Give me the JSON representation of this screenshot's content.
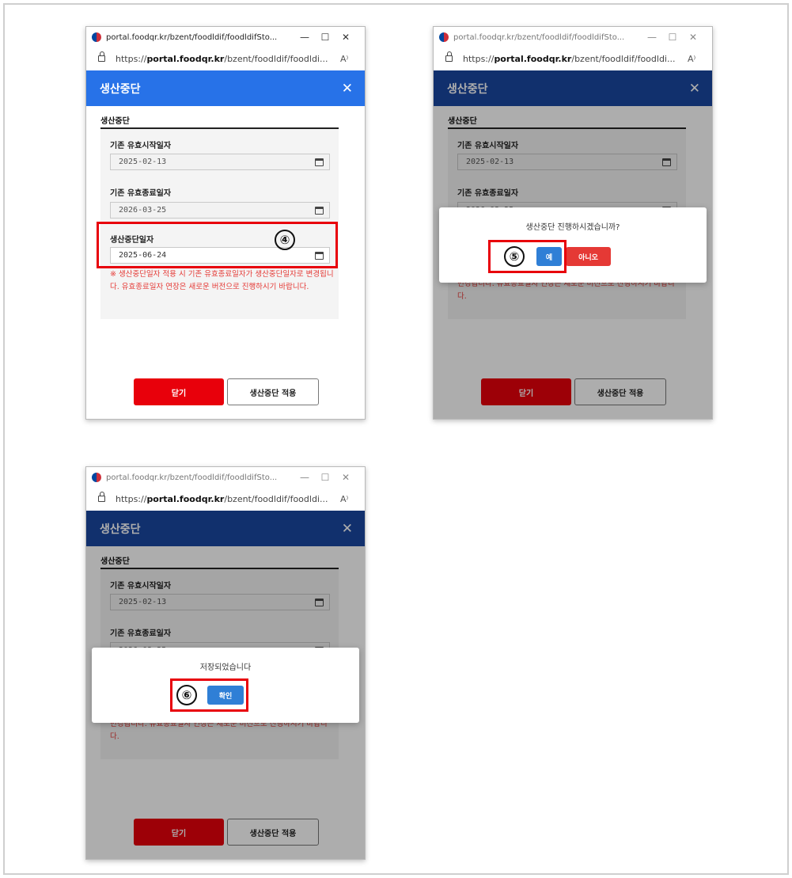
{
  "colors": {
    "header_active": "#2772e8",
    "header_dimmed": "#1a47a1",
    "primary_red": "#e8000b",
    "confirm_blue": "#2f7fd6",
    "warning_red": "#e53935"
  },
  "browser": {
    "title": "portal.foodqr.kr/bzent/foodldif/foodldifSto...",
    "url_prefix": "https://",
    "url_domain": "portal.foodqr.kr",
    "url_path": "/bzent/foodldif/foodldi...",
    "minimize": "—",
    "maximize": "☐",
    "close": "✕",
    "read_aloud": "A⁾"
  },
  "popup": {
    "header_title": "생산중단",
    "close_symbol": "✕",
    "section_title": "생산중단",
    "fields": [
      {
        "label": "기존 유효시작일자",
        "value": "2025-02-13"
      },
      {
        "label": "기존 유효종료일자",
        "value": "2026-03-25"
      },
      {
        "label": "생산중단일자",
        "value": "2025-06-24"
      }
    ],
    "warning_full": "※ 생산중단일자 적용 시 기존 유효종료일자가 생산중단일자로 변경됩니다. 유효종료일자 연장은 새로운 버전으로 진행하시기 바랍니다.",
    "warning_partial": "변경됩니다. 유효종료일자 연장은 새로운 버전으로 진행하시기 바랍니다.",
    "partial_date": "2026-03-25",
    "close_button": "닫기",
    "apply_button": "생산중단 적용"
  },
  "confirm_dialog": {
    "message": "생산중단 진행하시겠습니까?",
    "yes": "예",
    "no": "아니오"
  },
  "saved_dialog": {
    "message": "저장되었습니다",
    "ok": "확인"
  },
  "steps": [
    "④",
    "⑤",
    "⑥"
  ]
}
